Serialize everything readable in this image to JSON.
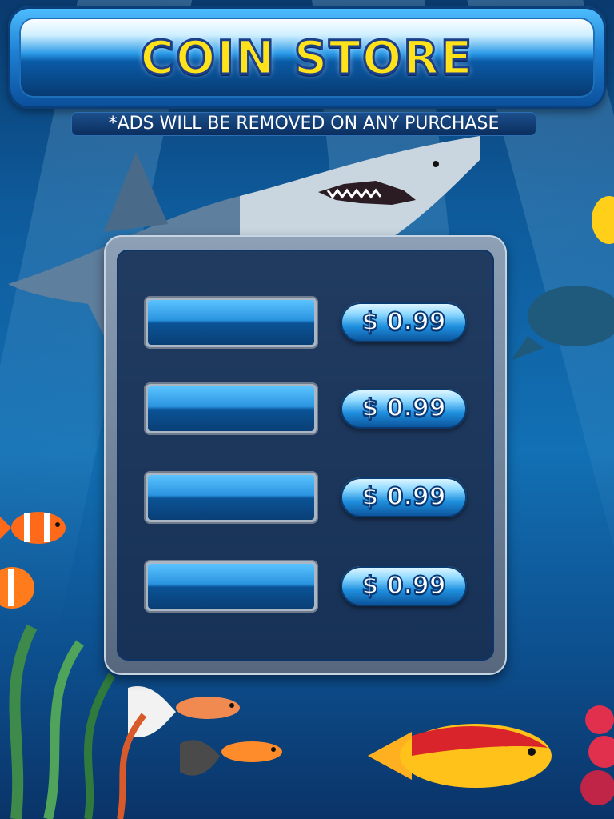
{
  "store": {
    "title": "COIN STORE",
    "notice": "*ADS WILL BE REMOVED ON ANY PURCHASE"
  },
  "packages": [
    {
      "coins": "",
      "price": "$ 0.99"
    },
    {
      "coins": "",
      "price": "$ 0.99"
    },
    {
      "coins": "",
      "price": "$ 0.99"
    },
    {
      "coins": "",
      "price": "$ 0.99"
    }
  ],
  "colors": {
    "title_fill": "#ffe21a",
    "title_stroke": "#1b3f8a",
    "ocean": "#1270b4",
    "button": "#1f90df"
  }
}
